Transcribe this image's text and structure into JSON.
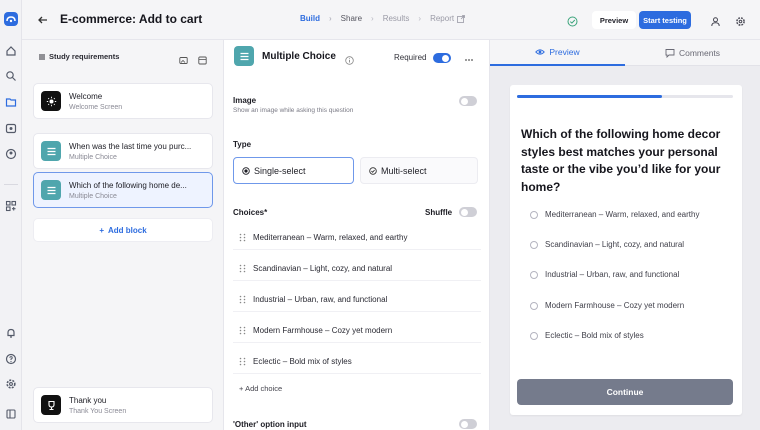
{
  "icons": {
    "rail": [
      "app-logo-icon",
      "home-icon",
      "search-icon",
      "folder-icon",
      "calendar-icon",
      "users-icon",
      "integrations-icon",
      "bell-icon",
      "help-icon",
      "settings-icon",
      "sidebar-toggle-icon"
    ],
    "back": "arrow-left-icon"
  },
  "header": {
    "title": "E-commerce: Add to cart",
    "steps": [
      "Build",
      "Share",
      "Results",
      "Report"
    ],
    "preview_label": "Preview",
    "start_label": "Start testing"
  },
  "requirements": {
    "heading": "Study requirements",
    "blocks": [
      {
        "title": "Welcome",
        "subtitle": "Welcome Screen"
      },
      {
        "title": "When was the last time you purc...",
        "subtitle": "Multiple Choice"
      },
      {
        "title": "Which of the following home de...",
        "subtitle": "Multiple Choice"
      }
    ],
    "add_block": "Add block",
    "thank_you": {
      "title": "Thank you",
      "subtitle": "Thank You Screen"
    }
  },
  "editor": {
    "title": "Multiple Choice",
    "required_label": "Required",
    "required": true,
    "image_label": "Image",
    "image_sub": "Show an image while asking this question",
    "image_on": false,
    "type_label": "Type",
    "type_single": "Single-select",
    "type_multi": "Multi-select",
    "choices_label": "Choices*",
    "shuffle_label": "Shuffle",
    "shuffle_on": false,
    "choices": [
      "Mediterranean – Warm, relaxed, and earthy",
      "Scandinavian – Light, cozy, and natural",
      "Industrial – Urban, raw, and functional",
      "Modern Farmhouse – Cozy yet modern",
      "Eclectic – Bold mix of styles"
    ],
    "add_choice": "Add choice",
    "other_label": "'Other' option input",
    "other_on": false
  },
  "preview": {
    "tab_preview": "Preview",
    "tab_comments": "Comments",
    "progress": 0.67,
    "question": "Which of the following home decor styles best matches your personal taste or the vibe you’d like for your home?",
    "options": [
      "Mediterranean – Warm, relaxed, and earthy",
      "Scandinavian – Light, cozy, and natural",
      "Industrial – Urban, raw, and functional",
      "Modern Farmhouse – Cozy yet modern",
      "Eclectic – Bold mix of styles"
    ],
    "continue_label": "Continue"
  },
  "colors": {
    "accent": "#2d6cdf",
    "teal": "#4fa6ad",
    "continue": "#757b8c"
  }
}
